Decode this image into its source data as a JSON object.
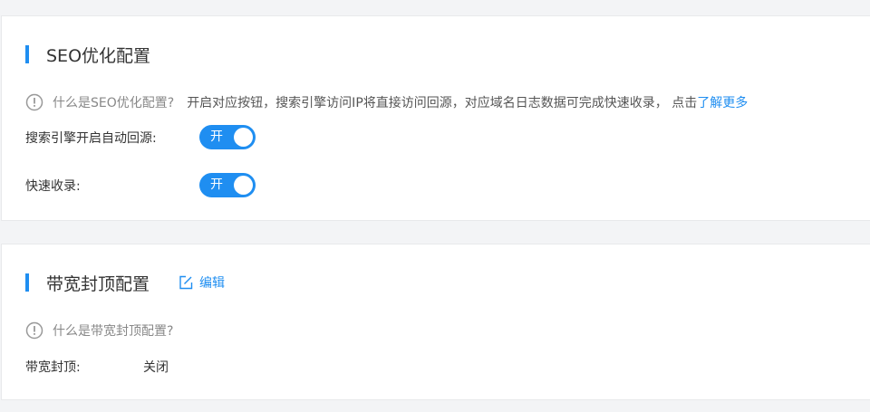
{
  "seo_section": {
    "title": "SEO优化配置",
    "info_question": "什么是SEO优化配置?",
    "info_description": "开启对应按钮，搜索引擎访问IP将直接访问回源，对应域名日志数据可完成快速收录，  点击",
    "info_link": "了解更多",
    "settings": [
      {
        "label": "搜索引擎开启自动回源:",
        "toggle_text": "开",
        "state": "on"
      },
      {
        "label": "快速收录:",
        "toggle_text": "开",
        "state": "on"
      }
    ]
  },
  "bandwidth_section": {
    "title": "带宽封顶配置",
    "edit_label": "编辑",
    "info_question": "什么是带宽封顶配置?",
    "setting": {
      "label": "带宽封顶:",
      "value": "关闭"
    }
  },
  "icons": {
    "info": "info-circle-icon",
    "edit": "edit-icon"
  },
  "colors": {
    "accent": "#1f8ef1",
    "background": "#f3f4f6",
    "panel": "#ffffff",
    "muted_text": "#888888"
  }
}
